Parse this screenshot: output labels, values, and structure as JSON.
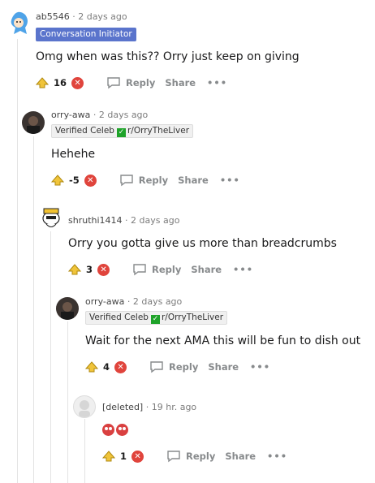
{
  "comments": [
    {
      "username": "ab5546",
      "sep": "·",
      "time": "2 days ago",
      "flair": "Conversation Initiator",
      "body": "Omg when was this?? Orry just keep on giving",
      "score": "16",
      "reply_label": "Reply",
      "share_label": "Share",
      "more_label": "•••"
    },
    {
      "username": "orry-awa",
      "sep": "·",
      "time": "2 days ago",
      "flair_a": "Verified Celeb",
      "flair_b": "r/OrryTheLiver",
      "body": "Hehehe",
      "score": "-5",
      "reply_label": "Reply",
      "share_label": "Share",
      "more_label": "•••"
    },
    {
      "username": "shruthi1414",
      "sep": "·",
      "time": "2 days ago",
      "body": "Orry you gotta give us more than breadcrumbs",
      "score": "3",
      "reply_label": "Reply",
      "share_label": "Share",
      "more_label": "•••"
    },
    {
      "username": "orry-awa",
      "sep": "·",
      "time": "2 days ago",
      "flair_a": "Verified Celeb",
      "flair_b": "r/OrryTheLiver",
      "body": "Wait for the next AMA this will be fun to dish out",
      "score": "4",
      "reply_label": "Reply",
      "share_label": "Share",
      "more_label": "•••"
    },
    {
      "username": "[deleted]",
      "sep": "·",
      "time": "19 hr. ago",
      "body_icons": [
        "clown-emoji",
        "clown-emoji"
      ],
      "score": "1",
      "reply_label": "Reply",
      "share_label": "Share",
      "more_label": "•••"
    }
  ],
  "colors": {
    "op_flair_bg": "#5a74cc",
    "downvote": "#e0443c",
    "upvote": "#f0c43a",
    "verified": "#1fa32a"
  },
  "icons": {
    "upvote": "upvote-arrow-icon",
    "downvote": "downvote-x-icon",
    "reply": "speech-bubble-icon",
    "check": "check-mark-icon"
  }
}
